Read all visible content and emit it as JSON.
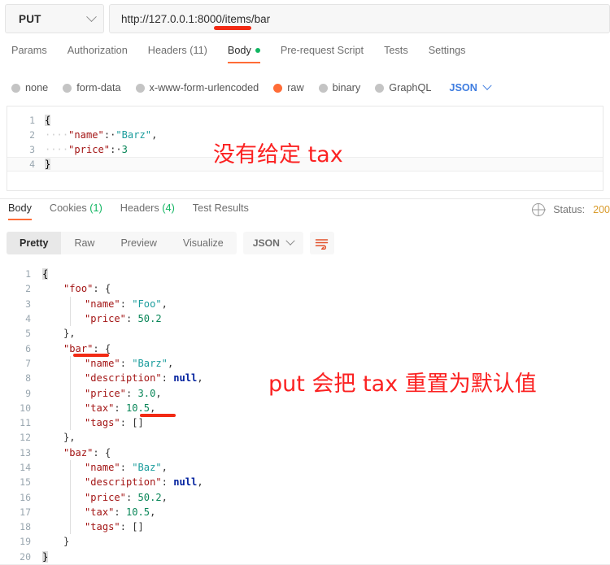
{
  "request": {
    "method": "PUT",
    "url": "http://127.0.0.1:8000/items/bar",
    "tabs": [
      {
        "label": "Params",
        "active": false,
        "dot": false
      },
      {
        "label": "Authorization",
        "active": false,
        "dot": false
      },
      {
        "label": "Headers (11)",
        "active": false,
        "dot": false
      },
      {
        "label": "Body",
        "active": true,
        "dot": true
      },
      {
        "label": "Pre-request Script",
        "active": false,
        "dot": false
      },
      {
        "label": "Tests",
        "active": false,
        "dot": false
      },
      {
        "label": "Settings",
        "active": false,
        "dot": false
      }
    ],
    "body_types": [
      {
        "label": "none",
        "selected": false
      },
      {
        "label": "form-data",
        "selected": false
      },
      {
        "label": "x-www-form-urlencoded",
        "selected": false
      },
      {
        "label": "raw",
        "selected": true
      },
      {
        "label": "binary",
        "selected": false
      },
      {
        "label": "GraphQL",
        "selected": false
      }
    ],
    "format_label": "JSON",
    "editor_lines": [
      {
        "n": "1",
        "segments": [
          {
            "t": "{",
            "c": "caret"
          }
        ]
      },
      {
        "n": "2",
        "segments": [
          {
            "t": "····",
            "c": "dots"
          },
          {
            "t": "\"name\"",
            "c": "k"
          },
          {
            "t": ":·",
            "c": "p"
          },
          {
            "t": "\"Barz\"",
            "c": "s"
          },
          {
            "t": ",",
            "c": "p"
          }
        ]
      },
      {
        "n": "3",
        "segments": [
          {
            "t": "····",
            "c": "dots"
          },
          {
            "t": "\"price\"",
            "c": "k"
          },
          {
            "t": ":·",
            "c": "p"
          },
          {
            "t": "3",
            "c": "n"
          }
        ]
      },
      {
        "n": "4",
        "segments": [
          {
            "t": "}",
            "c": "caret"
          }
        ]
      }
    ],
    "annotation": "没有给定 tax"
  },
  "response": {
    "tabs": [
      {
        "label": "Body",
        "count": "",
        "active": true
      },
      {
        "label": "Cookies",
        "count": "(1)",
        "active": false
      },
      {
        "label": "Headers",
        "count": "(4)",
        "active": false
      },
      {
        "label": "Test Results",
        "count": "",
        "active": false
      }
    ],
    "status_label": "Status:",
    "status_value": "200",
    "view_modes": [
      {
        "label": "Pretty",
        "active": true
      },
      {
        "label": "Raw",
        "active": false
      },
      {
        "label": "Preview",
        "active": false
      },
      {
        "label": "Visualize",
        "active": false
      }
    ],
    "format_label": "JSON",
    "annotation": "put 会把 tax 重置为默认值",
    "lines": [
      {
        "n": "1",
        "indent": 0,
        "guide": 0,
        "segments": [
          {
            "t": "{",
            "c": "caret"
          }
        ]
      },
      {
        "n": "2",
        "indent": 1,
        "guide": 0,
        "segments": [
          {
            "t": "\"foo\"",
            "c": "k"
          },
          {
            "t": ": {",
            "c": "p"
          }
        ]
      },
      {
        "n": "3",
        "indent": 2,
        "guide": 1,
        "segments": [
          {
            "t": "\"name\"",
            "c": "k"
          },
          {
            "t": ": ",
            "c": "p"
          },
          {
            "t": "\"Foo\"",
            "c": "s"
          },
          {
            "t": ",",
            "c": "p"
          }
        ]
      },
      {
        "n": "4",
        "indent": 2,
        "guide": 1,
        "segments": [
          {
            "t": "\"price\"",
            "c": "k"
          },
          {
            "t": ": ",
            "c": "p"
          },
          {
            "t": "50.2",
            "c": "n"
          }
        ]
      },
      {
        "n": "5",
        "indent": 1,
        "guide": 0,
        "segments": [
          {
            "t": "},",
            "c": "p"
          }
        ]
      },
      {
        "n": "6",
        "indent": 1,
        "guide": 0,
        "segments": [
          {
            "t": "\"bar\"",
            "c": "k"
          },
          {
            "t": ": {",
            "c": "p"
          }
        ]
      },
      {
        "n": "7",
        "indent": 2,
        "guide": 1,
        "segments": [
          {
            "t": "\"name\"",
            "c": "k"
          },
          {
            "t": ": ",
            "c": "p"
          },
          {
            "t": "\"Barz\"",
            "c": "s"
          },
          {
            "t": ",",
            "c": "p"
          }
        ]
      },
      {
        "n": "8",
        "indent": 2,
        "guide": 1,
        "segments": [
          {
            "t": "\"description\"",
            "c": "k"
          },
          {
            "t": ": ",
            "c": "p"
          },
          {
            "t": "null",
            "c": "nul"
          },
          {
            "t": ",",
            "c": "p"
          }
        ]
      },
      {
        "n": "9",
        "indent": 2,
        "guide": 1,
        "segments": [
          {
            "t": "\"price\"",
            "c": "k"
          },
          {
            "t": ": ",
            "c": "p"
          },
          {
            "t": "3.0",
            "c": "n"
          },
          {
            "t": ",",
            "c": "p"
          }
        ]
      },
      {
        "n": "10",
        "indent": 2,
        "guide": 1,
        "segments": [
          {
            "t": "\"tax\"",
            "c": "k"
          },
          {
            "t": ": ",
            "c": "p"
          },
          {
            "t": "10.5",
            "c": "n"
          },
          {
            "t": ",",
            "c": "p"
          }
        ]
      },
      {
        "n": "11",
        "indent": 2,
        "guide": 1,
        "segments": [
          {
            "t": "\"tags\"",
            "c": "k"
          },
          {
            "t": ": []",
            "c": "p"
          }
        ]
      },
      {
        "n": "12",
        "indent": 1,
        "guide": 0,
        "segments": [
          {
            "t": "},",
            "c": "p"
          }
        ]
      },
      {
        "n": "13",
        "indent": 1,
        "guide": 0,
        "segments": [
          {
            "t": "\"baz\"",
            "c": "k"
          },
          {
            "t": ": {",
            "c": "p"
          }
        ]
      },
      {
        "n": "14",
        "indent": 2,
        "guide": 1,
        "segments": [
          {
            "t": "\"name\"",
            "c": "k"
          },
          {
            "t": ": ",
            "c": "p"
          },
          {
            "t": "\"Baz\"",
            "c": "s"
          },
          {
            "t": ",",
            "c": "p"
          }
        ]
      },
      {
        "n": "15",
        "indent": 2,
        "guide": 1,
        "segments": [
          {
            "t": "\"description\"",
            "c": "k"
          },
          {
            "t": ": ",
            "c": "p"
          },
          {
            "t": "null",
            "c": "nul"
          },
          {
            "t": ",",
            "c": "p"
          }
        ]
      },
      {
        "n": "16",
        "indent": 2,
        "guide": 1,
        "segments": [
          {
            "t": "\"price\"",
            "c": "k"
          },
          {
            "t": ": ",
            "c": "p"
          },
          {
            "t": "50.2",
            "c": "n"
          },
          {
            "t": ",",
            "c": "p"
          }
        ]
      },
      {
        "n": "17",
        "indent": 2,
        "guide": 1,
        "segments": [
          {
            "t": "\"tax\"",
            "c": "k"
          },
          {
            "t": ": ",
            "c": "p"
          },
          {
            "t": "10.5",
            "c": "n"
          },
          {
            "t": ",",
            "c": "p"
          }
        ]
      },
      {
        "n": "18",
        "indent": 2,
        "guide": 1,
        "segments": [
          {
            "t": "\"tags\"",
            "c": "k"
          },
          {
            "t": ": []",
            "c": "p"
          }
        ]
      },
      {
        "n": "19",
        "indent": 1,
        "guide": 0,
        "segments": [
          {
            "t": "}",
            "c": "p"
          }
        ]
      },
      {
        "n": "20",
        "indent": 0,
        "guide": 0,
        "segments": [
          {
            "t": "}",
            "c": "caret"
          }
        ]
      }
    ]
  },
  "colors": {
    "accent": "#ff6c37",
    "annotation_red": "#fb2222",
    "underline_red": "#f22a14",
    "json_blue": "#3f7de0",
    "status_green": "#10b561"
  }
}
